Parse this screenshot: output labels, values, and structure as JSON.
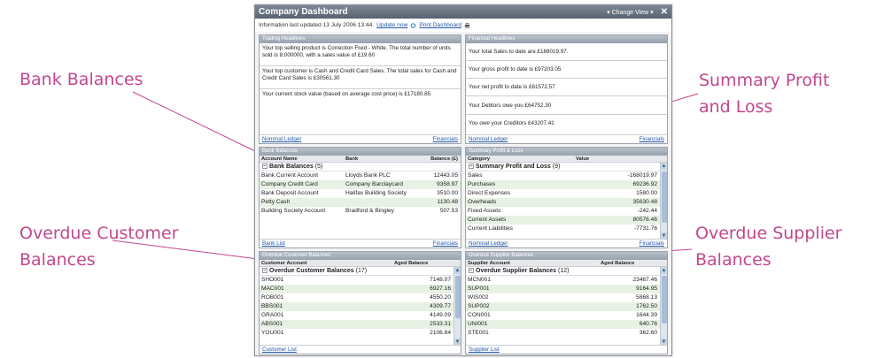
{
  "annotations": {
    "bank": "Bank Balances",
    "summary_1": "Summary Profit",
    "summary_2": "and Loss",
    "overdue_customer_1": "Overdue Customer",
    "overdue_customer_2": "Balances",
    "overdue_supplier_1": "Overdue Supplier",
    "overdue_supplier_2": "Balances"
  },
  "window": {
    "title": "Company Dashboard",
    "change_view": "▾  Change View ▾",
    "close": "✕"
  },
  "info": {
    "text": "Information last updated 13 July 2006 13:44.",
    "update_now": "Update now",
    "print": "Print Dashboard"
  },
  "trading": {
    "title": "Trading Headlines",
    "items": [
      "Your top selling product is Correction Fluid - White. The total number of units sold is 8.000000, with a sales value of £19.60",
      "Your top customer is Cash and Credit Card Sales. The total sales for Cash and Credit Card Sales is £30561.30",
      "Your current stock value (based on average cost price) is £17180.85"
    ],
    "footer_left": "Nominal Ledger",
    "footer_right": "Financials"
  },
  "financial": {
    "title": "Financial Headlines",
    "items": [
      "Your total Sales to date are £168019.97.",
      "Your gross profit to date is £97203.05",
      "Your net profit to date is £61572.57",
      "Your Debtors owe you £64752.30",
      "You owe your Creditors £43207.41"
    ],
    "footer_left": "Nominal Ledger",
    "footer_right": "Financials"
  },
  "bank": {
    "title": "Bank Balances",
    "columns": [
      "Account Name",
      "Bank",
      "Balance (£)"
    ],
    "group": "Bank Balances",
    "group_count": "(5)",
    "rows": [
      [
        "Bank Current Account",
        "Lloyds Bank PLC",
        "12443.05"
      ],
      [
        "Company Credit Card",
        "Company Barclaycard",
        "9358.97"
      ],
      [
        "Bank Deposit Account",
        "Halifax Building Society",
        "3510.00"
      ],
      [
        "Petty Cash",
        "",
        "1130.48"
      ],
      [
        "Building Society Account",
        "Bradford & Bingley",
        "507.53"
      ]
    ],
    "footer_left": "Bank List",
    "footer_right": "Financials"
  },
  "summary": {
    "title": "Summary Profit & Loss",
    "columns": [
      "Category",
      "Value"
    ],
    "group": "Summary Profit and Loss",
    "group_count": "(9)",
    "rows": [
      [
        "Sales",
        "-168019.97"
      ],
      [
        "Purchases",
        "69236.92"
      ],
      [
        "Direct Expenses",
        "1580.00"
      ],
      [
        "Overheads",
        "35630.48"
      ],
      [
        "Fixed Assets",
        "-242.44"
      ],
      [
        "Current Assets",
        "80576.46"
      ],
      [
        "Current Liabilities",
        "-7731.76"
      ]
    ],
    "footer_left": "Nominal Ledger",
    "footer_right": "Financials"
  },
  "customer": {
    "title": "Overdue Customer Balances",
    "columns": [
      "Customer Account",
      "Aged Balance"
    ],
    "group": "Overdue Customer Balances",
    "group_count": "(17)",
    "rows": [
      [
        "SHO001",
        "7148.07"
      ],
      [
        "MAC001",
        "6927.16"
      ],
      [
        "ROB001",
        "4550.20"
      ],
      [
        "BBS001",
        "4309.77"
      ],
      [
        "GRA001",
        "4149.09"
      ],
      [
        "ABS001",
        "2533.31"
      ],
      [
        "YOU001",
        "2106.84"
      ]
    ],
    "footer_left": "Customer List"
  },
  "supplier": {
    "title": "Overdue Supplier Balances",
    "columns": [
      "Supplier Account",
      "Aged Balance"
    ],
    "group": "Overdue Supplier Balances",
    "group_count": "(12)",
    "rows": [
      [
        "MCN001",
        "23467.46"
      ],
      [
        "SUP001",
        "9164.95"
      ],
      [
        "WIS002",
        "5868.13"
      ],
      [
        "SUP002",
        "1762.50"
      ],
      [
        "CON001",
        "1644.39"
      ],
      [
        "UNI001",
        "640.76"
      ],
      [
        "STE001",
        "362.60"
      ]
    ],
    "footer_left": "Supplier List"
  },
  "colors": {
    "annotation": "#c2478e",
    "link": "#2255aa",
    "row_alt": "#e7f1e4"
  }
}
